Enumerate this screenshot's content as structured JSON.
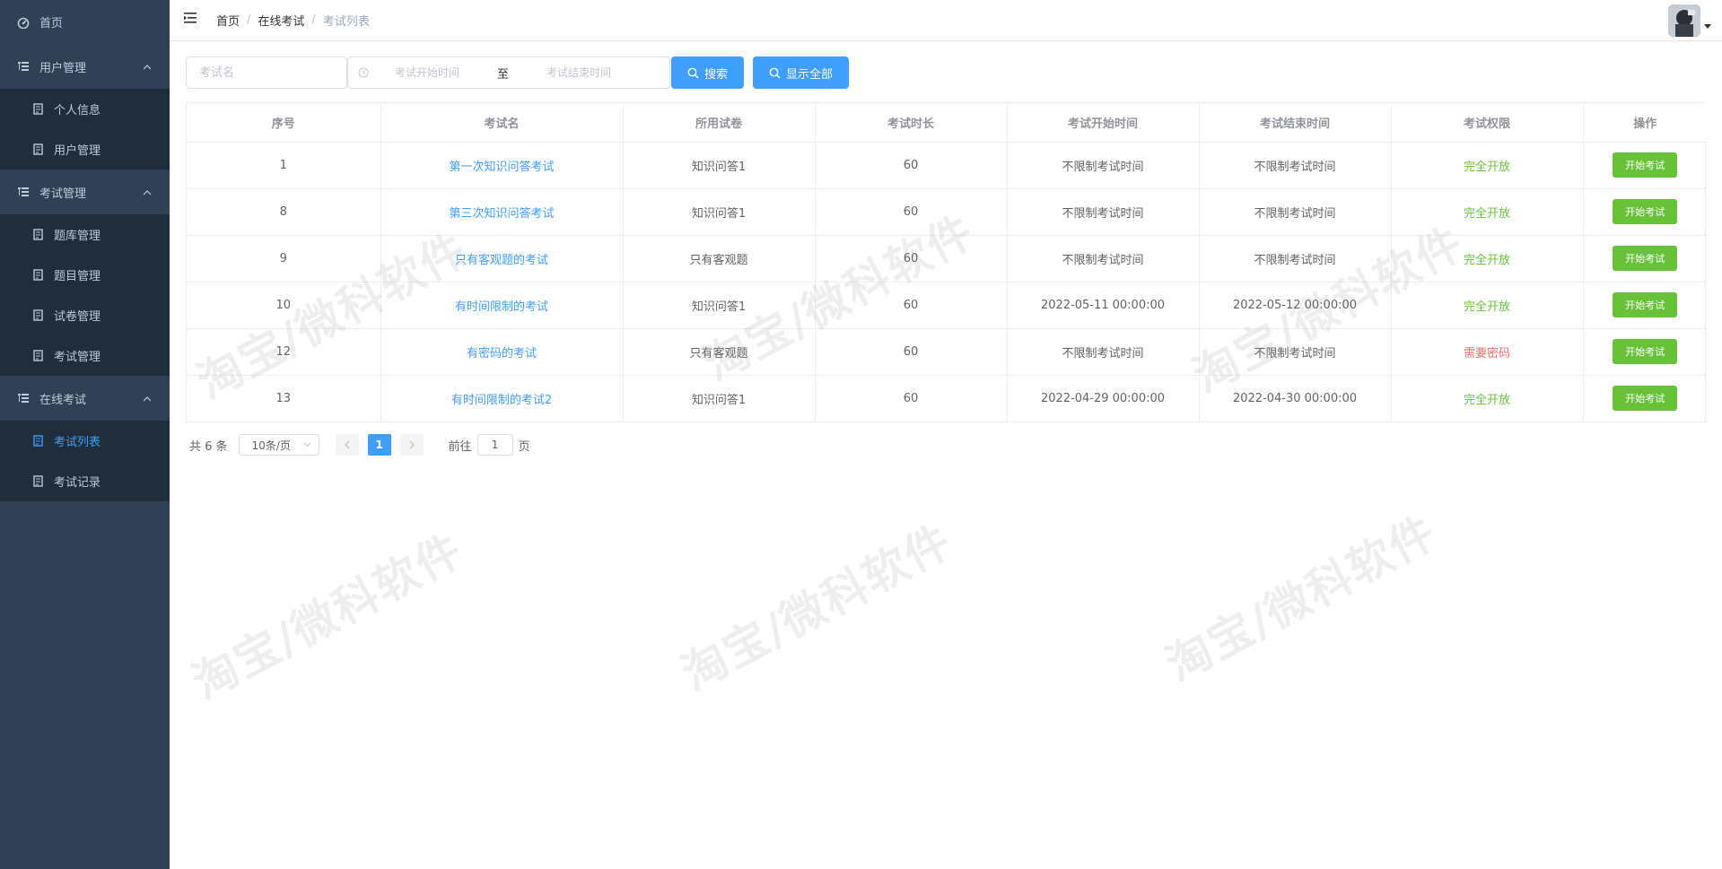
{
  "sidebar": {
    "home": "首页",
    "groups": [
      {
        "title": "用户管理",
        "items": [
          {
            "label": "个人信息"
          },
          {
            "label": "用户管理"
          }
        ]
      },
      {
        "title": "考试管理",
        "items": [
          {
            "label": "题库管理"
          },
          {
            "label": "题目管理"
          },
          {
            "label": "试卷管理"
          },
          {
            "label": "考试管理"
          }
        ]
      },
      {
        "title": "在线考试",
        "items": [
          {
            "label": "考试列表"
          },
          {
            "label": "考试记录"
          }
        ]
      }
    ]
  },
  "header": {
    "breadcrumb": [
      "首页",
      "在线考试",
      "考试列表"
    ],
    "separator": "/"
  },
  "toolbar": {
    "name_placeholder": "考试名",
    "start_placeholder": "考试开始时间",
    "to_label": "至",
    "end_placeholder": "考试结束时间",
    "search_label": "搜索",
    "show_all_label": "显示全部"
  },
  "table": {
    "headers": [
      "序号",
      "考试名",
      "所用试卷",
      "考试时长",
      "考试开始时间",
      "考试结束时间",
      "考试权限",
      "操作"
    ],
    "rows": [
      {
        "id": "1",
        "name": "第一次知识问答考试",
        "paper": "知识问答1",
        "duration": "60",
        "start": "不限制考试时间",
        "end": "不限制考试时间",
        "perm": "完全开放",
        "perm_type": "open",
        "action": "开始考试"
      },
      {
        "id": "8",
        "name": "第三次知识问答考试",
        "paper": "知识问答1",
        "duration": "60",
        "start": "不限制考试时间",
        "end": "不限制考试时间",
        "perm": "完全开放",
        "perm_type": "open",
        "action": "开始考试"
      },
      {
        "id": "9",
        "name": "只有客观题的考试",
        "paper": "只有客观题",
        "duration": "60",
        "start": "不限制考试时间",
        "end": "不限制考试时间",
        "perm": "完全开放",
        "perm_type": "open",
        "action": "开始考试"
      },
      {
        "id": "10",
        "name": "有时间限制的考试",
        "paper": "知识问答1",
        "duration": "60",
        "start": "2022-05-11 00:00:00",
        "end": "2022-05-12 00:00:00",
        "perm": "完全开放",
        "perm_type": "open",
        "action": "开始考试"
      },
      {
        "id": "12",
        "name": "有密码的考试",
        "paper": "只有客观题",
        "duration": "60",
        "start": "不限制考试时间",
        "end": "不限制考试时间",
        "perm": "需要密码",
        "perm_type": "password",
        "action": "开始考试"
      },
      {
        "id": "13",
        "name": "有时间限制的考试2",
        "paper": "知识问答1",
        "duration": "60",
        "start": "2022-04-29 00:00:00",
        "end": "2022-04-30 00:00:00",
        "perm": "完全开放",
        "perm_type": "open",
        "action": "开始考试"
      }
    ]
  },
  "pagination": {
    "total_text": "共 6 条",
    "page_size": "10条/页",
    "current_page": "1",
    "goto_prefix": "前往",
    "goto_value": "1",
    "goto_suffix": "页"
  },
  "watermark": "淘宝/微科软件",
  "colors": {
    "sidebar_bg": "#304156",
    "submenu_bg": "#1f2d3d",
    "primary": "#409eff",
    "success": "#67c23a",
    "danger": "#f56c6c"
  }
}
